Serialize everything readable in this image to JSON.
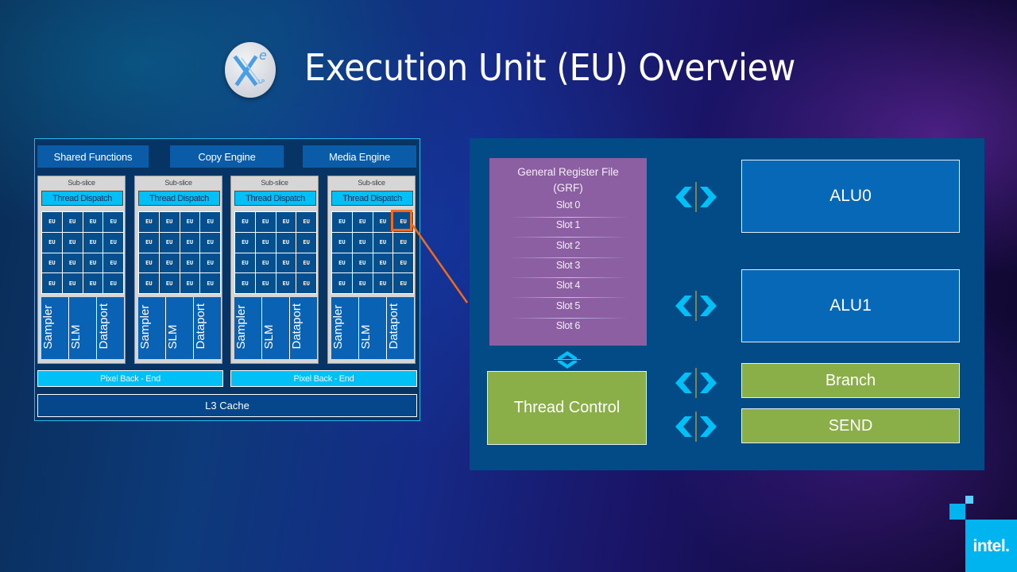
{
  "slide": {
    "title": "Execution Unit (EU) Overview",
    "logo": {
      "main": "X",
      "superscript": "e",
      "subscript": "LP",
      "icon": "xe-lp-logo-icon"
    }
  },
  "gpu_overview": {
    "top_blocks": [
      "Shared Functions",
      "Copy Engine",
      "Media Engine"
    ],
    "subslices": [
      {
        "label": "Sub-slice",
        "dispatch": "Thread Dispatch",
        "eus": [
          "EU",
          "EU",
          "EU",
          "EU",
          "EU",
          "EU",
          "EU",
          "EU",
          "EU",
          "EU",
          "EU",
          "EU",
          "EU",
          "EU",
          "EU",
          "EU"
        ],
        "units": [
          "Sampler",
          "SLM",
          "Dataport"
        ]
      },
      {
        "label": "Sub-slice",
        "dispatch": "Thread Dispatch",
        "eus": [
          "EU",
          "EU",
          "EU",
          "EU",
          "EU",
          "EU",
          "EU",
          "EU",
          "EU",
          "EU",
          "EU",
          "EU",
          "EU",
          "EU",
          "EU",
          "EU"
        ],
        "units": [
          "Sampler",
          "SLM",
          "Dataport"
        ]
      },
      {
        "label": "Sub-slice",
        "dispatch": "Thread Dispatch",
        "eus": [
          "EU",
          "EU",
          "EU",
          "EU",
          "EU",
          "EU",
          "EU",
          "EU",
          "EU",
          "EU",
          "EU",
          "EU",
          "EU",
          "EU",
          "EU",
          "EU"
        ],
        "units": [
          "Sampler",
          "SLM",
          "Dataport"
        ]
      },
      {
        "label": "Sub-slice",
        "dispatch": "Thread Dispatch",
        "eus": [
          "EU",
          "EU",
          "EU",
          "EU",
          "EU",
          "EU",
          "EU",
          "EU",
          "EU",
          "EU",
          "EU",
          "EU",
          "EU",
          "EU",
          "EU",
          "EU"
        ],
        "units": [
          "Sampler",
          "SLM",
          "Dataport"
        ]
      }
    ],
    "pixel_backends": [
      "Pixel Back - End",
      "Pixel Back - End"
    ],
    "l3_cache": "L3 Cache",
    "highlighted_eu": {
      "subslice_index": 3,
      "eu_index": 3
    },
    "highlight_color": "#f26a1b"
  },
  "eu_detail": {
    "grf": {
      "title": "General Register File",
      "subtitle": "(GRF)",
      "slots": [
        "Slot 0",
        "Slot 1",
        "Slot 2",
        "Slot 3",
        "Slot 4",
        "Slot 5",
        "Slot 6"
      ]
    },
    "thread_control": "Thread Control",
    "functional_units": [
      {
        "label": "ALU0",
        "kind": "alu"
      },
      {
        "label": "ALU1",
        "kind": "alu"
      },
      {
        "label": "Branch",
        "kind": "green"
      },
      {
        "label": "SEND",
        "kind": "green"
      }
    ],
    "colors": {
      "panel": "#024b86",
      "grf": "#8c5fa2",
      "alu": "#0868b8",
      "control": "#8aae48",
      "arrow": "#00c0f5",
      "arrow_divider": "#d4a82a"
    }
  },
  "branding": {
    "wordmark": "intel."
  }
}
